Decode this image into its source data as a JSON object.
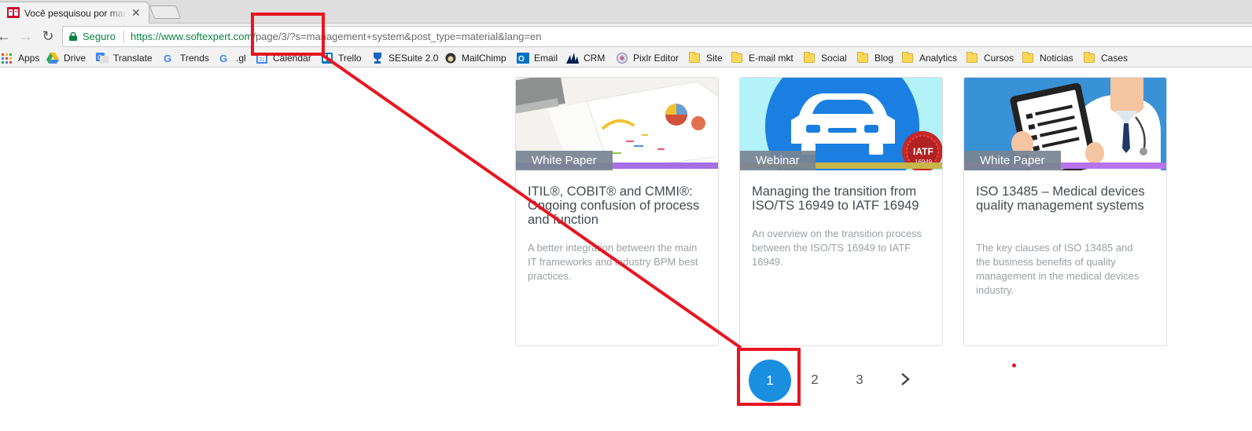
{
  "browser": {
    "tab": {
      "title": "Você pesquisou por man",
      "close_glyph": "✕"
    },
    "toolbar": {
      "secure_label": "Seguro",
      "url_host": "https://www.softexpert.com",
      "url_path": "/page/3/?s=management+system&post_type=material&lang=en"
    },
    "bookmarks": [
      {
        "label": "Apps",
        "icon": "apps-grid-icon"
      },
      {
        "label": "Drive",
        "icon": "drive-icon"
      },
      {
        "label": "Translate",
        "icon": "translate-icon"
      },
      {
        "label": "Trends",
        "icon": "google-icon"
      },
      {
        "label": ".gl",
        "icon": "google-icon"
      },
      {
        "label": "Calendar",
        "icon": "calendar-icon"
      },
      {
        "label": "Trello",
        "icon": "trello-icon"
      },
      {
        "label": "SESuite 2.0",
        "icon": "trophy-icon"
      },
      {
        "label": "MailChimp",
        "icon": "mailchimp-icon"
      },
      {
        "label": "Email",
        "icon": "outlook-icon"
      },
      {
        "label": "CRM",
        "icon": "dynamics-icon"
      },
      {
        "label": "Pixlr Editor",
        "icon": "pixlr-icon"
      },
      {
        "label": "Site",
        "icon": "folder-icon"
      },
      {
        "label": "E-mail mkt",
        "icon": "folder-icon"
      },
      {
        "label": "Social",
        "icon": "folder-icon"
      },
      {
        "label": "Blog",
        "icon": "folder-icon"
      },
      {
        "label": "Analytics",
        "icon": "folder-icon"
      },
      {
        "label": "Cursos",
        "icon": "folder-icon"
      },
      {
        "label": "Noticias",
        "icon": "folder-icon"
      },
      {
        "label": "Cases",
        "icon": "folder-icon"
      }
    ]
  },
  "cards": [
    {
      "badge": "White Paper",
      "title": "ITIL®, COBIT® and CMMI®: Ongoing confusion of process and function",
      "description": "A better integration between the main IT frameworks and industry BPM best practices.",
      "image": "documents-charts-image"
    },
    {
      "badge": "Webinar",
      "title": "Managing the transition from ISO/TS 16949 to IATF 16949",
      "description": "An overview on the transition process between the ISO/TS 16949 to IATF 16949.",
      "image": "car-iatf-image",
      "seal_line1": "IATF",
      "seal_line2": "16949"
    },
    {
      "badge": "White Paper",
      "title": "ISO 13485 – Medical devices quality management systems",
      "description": "The key clauses of ISO 13485 and the business benefits of quality management in the medical devices industry.",
      "image": "doctor-clipboard-image"
    }
  ],
  "pagination": {
    "pages": [
      "1",
      "2",
      "3"
    ],
    "current": "1",
    "next_icon": "chevron-right-icon"
  },
  "colors": {
    "annotation": "#e8151f",
    "page_active": "#1a8fe0",
    "badge_bg": "#788492",
    "secure_green": "#0b8043"
  }
}
